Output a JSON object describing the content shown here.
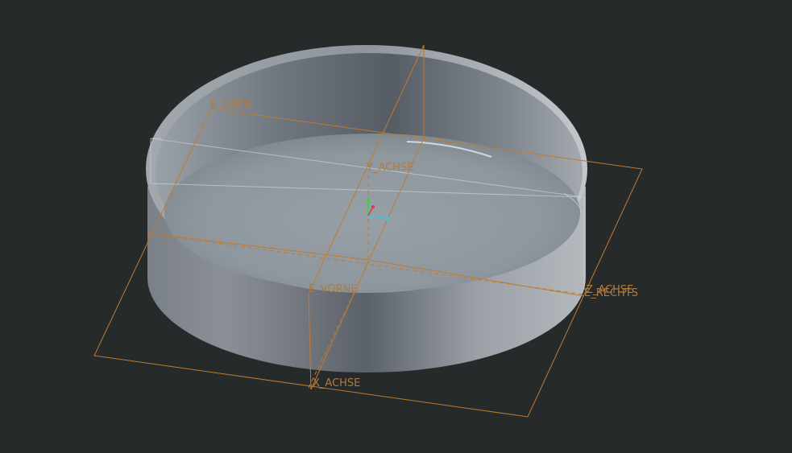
{
  "viewport": {
    "background": "#272a2b",
    "model": "cylindrical-tray",
    "model_color": "#8b939a",
    "datum_color": "#c07a30"
  },
  "datum_planes": {
    "top": "E_OBEN",
    "front": "E_VORNE",
    "right": "E_RECHTS"
  },
  "datum_axes": {
    "y": "Y_ACHSE",
    "x": "X_ACHSE",
    "z": "Z_ACHSE"
  },
  "csys": {
    "x_color": "#38c8d8",
    "y_color": "#3ecf3e",
    "z_color": "#e03a3a"
  }
}
